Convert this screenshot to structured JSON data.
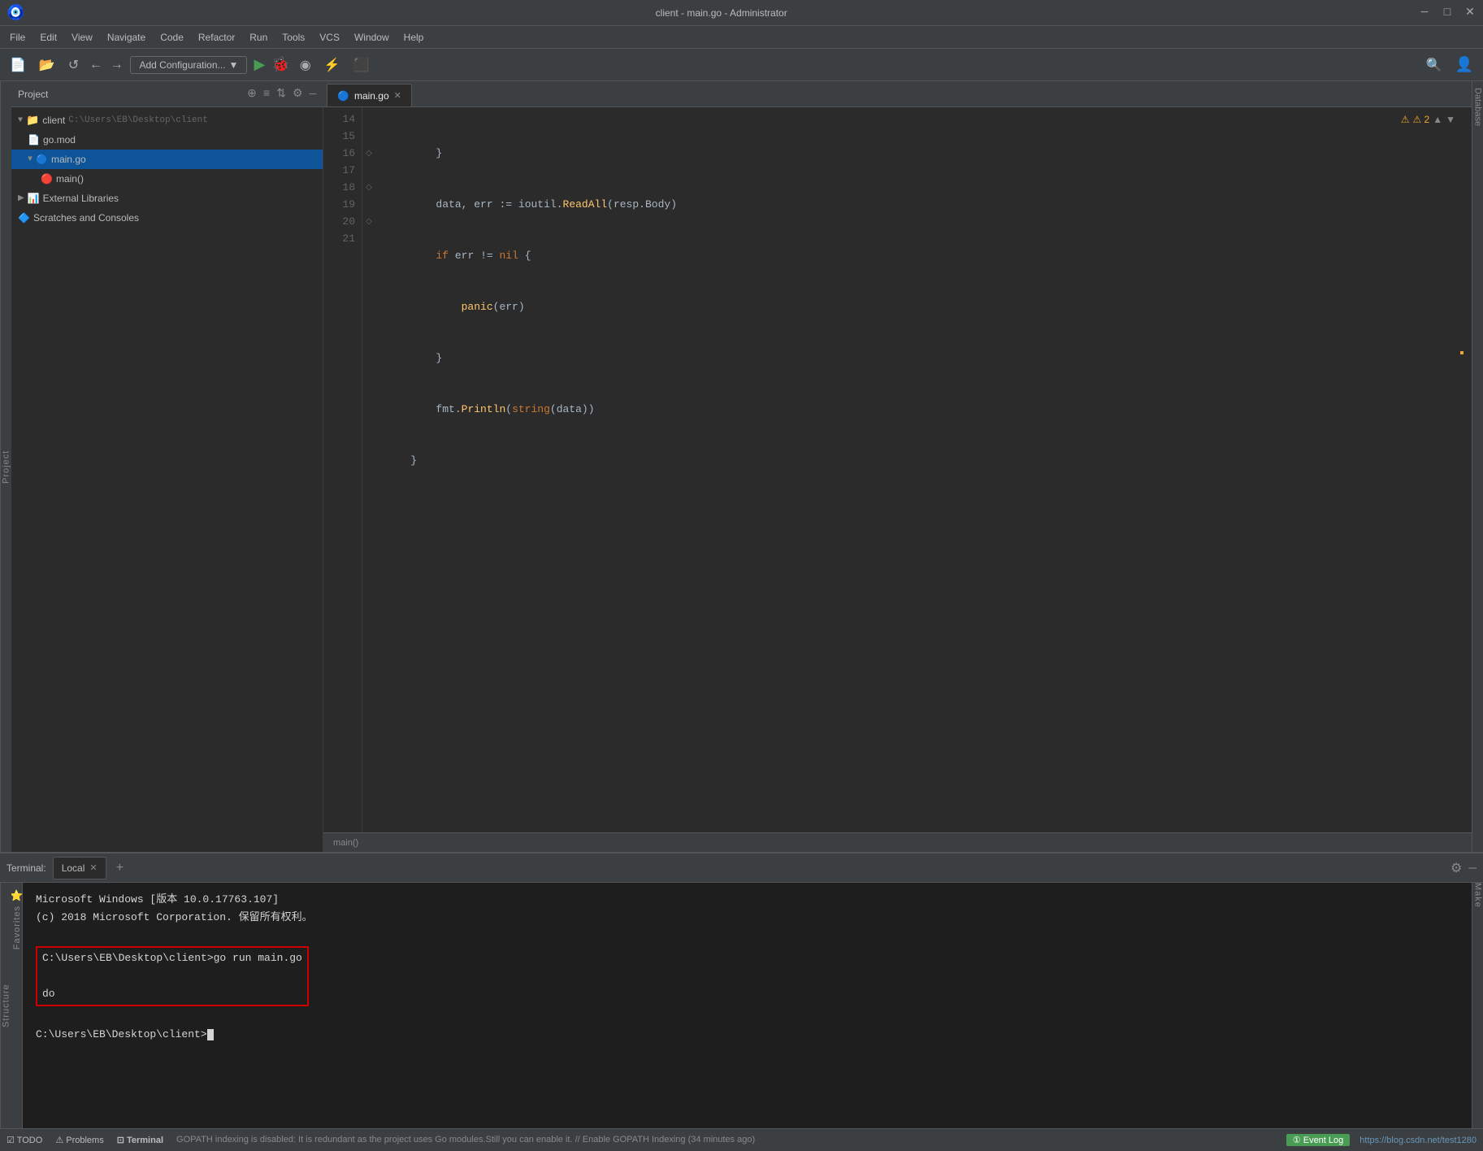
{
  "titleBar": {
    "title": "client - main.go - Administrator",
    "minimize": "─",
    "maximize": "□",
    "close": "✕"
  },
  "menuBar": {
    "items": [
      "File",
      "Edit",
      "View",
      "Navigate",
      "Code",
      "Refactor",
      "Run",
      "Tools",
      "VCS",
      "Window",
      "Help"
    ]
  },
  "toolbar": {
    "addConfig": "Add Configuration...",
    "addConfigArrow": "▼"
  },
  "projectTree": {
    "header": "Project",
    "items": [
      {
        "label": "client",
        "path": "C:\\Users\\EB\\Desktop\\client",
        "type": "folder",
        "indent": 0,
        "expanded": true
      },
      {
        "label": "go.mod",
        "type": "file",
        "indent": 1
      },
      {
        "label": "main.go",
        "type": "go",
        "indent": 1,
        "selected": true,
        "expanded": true
      },
      {
        "label": "main()",
        "type": "method",
        "indent": 2
      },
      {
        "label": "External Libraries",
        "type": "folder",
        "indent": 0,
        "expanded": false
      },
      {
        "label": "Scratches and Consoles",
        "type": "scratches",
        "indent": 0
      }
    ]
  },
  "editorTab": {
    "filename": "main.go",
    "active": true
  },
  "codeLines": [
    {
      "num": 14,
      "content": "        }"
    },
    {
      "num": 15,
      "content": "        data, err := ioutil.ReadAll(resp.Body)"
    },
    {
      "num": 16,
      "content": "        if err != nil {"
    },
    {
      "num": 17,
      "content": "            panic(err)"
    },
    {
      "num": 18,
      "content": "        }"
    },
    {
      "num": 19,
      "content": "        fmt.Println(string(data))"
    },
    {
      "num": 20,
      "content": "    }"
    },
    {
      "num": 21,
      "content": ""
    }
  ],
  "warningIndicator": "⚠ 2",
  "footerFunction": "main()",
  "terminal": {
    "label": "Terminal:",
    "tab": "Local",
    "lines": [
      "Microsoft Windows [版本 10.0.17763.107]",
      "(c) 2018 Microsoft Corporation. 保留所有权利。",
      "",
      "C:\\Users\\EB\\Desktop\\client>go run main.go",
      "do",
      "",
      "C:\\Users\\EB\\Desktop\\client>"
    ],
    "highlightLines": [
      "C:\\Users\\EB\\Desktop\\client>go run main.go",
      "do"
    ],
    "prompt": "C:\\Users\\EB\\Desktop\\client>"
  },
  "bottomBar": {
    "todo": "TODO",
    "problems": "⚠ Problems",
    "terminal": "⊡ Terminal",
    "statusMsg": "GOPATH indexing is disabled: It is redundant as the project uses Go modules.Still you can enable it. // Enable GOPATH Indexing (34 minutes ago)",
    "eventLog": "① Event Log",
    "url": "https://blog.csdn.net/test1280"
  },
  "rightPanel": {
    "database": "Database"
  },
  "leftPanels": {
    "project": "Project",
    "structure": "Structure",
    "favorites": "Favorites"
  },
  "rightPanels": {
    "make": "Make"
  }
}
